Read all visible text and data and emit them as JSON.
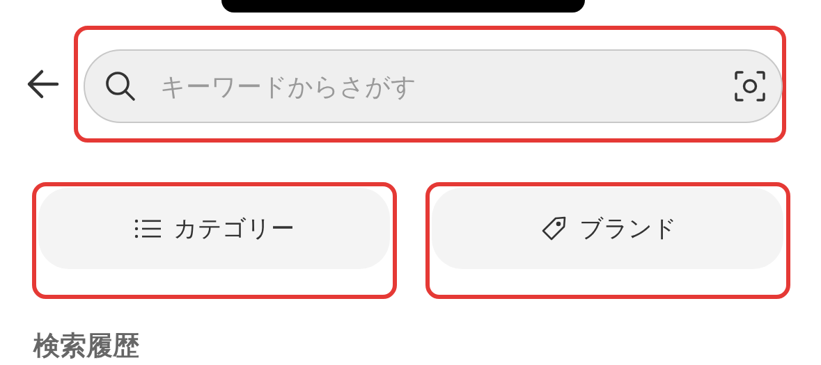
{
  "search": {
    "placeholder": "キーワードからさがす",
    "highlighted": true
  },
  "buttons": [
    {
      "kind": "category",
      "label": "カテゴリー",
      "highlighted": true
    },
    {
      "kind": "brand",
      "label": "ブランド",
      "highlighted": true
    }
  ],
  "section_heading": "検索履歴"
}
